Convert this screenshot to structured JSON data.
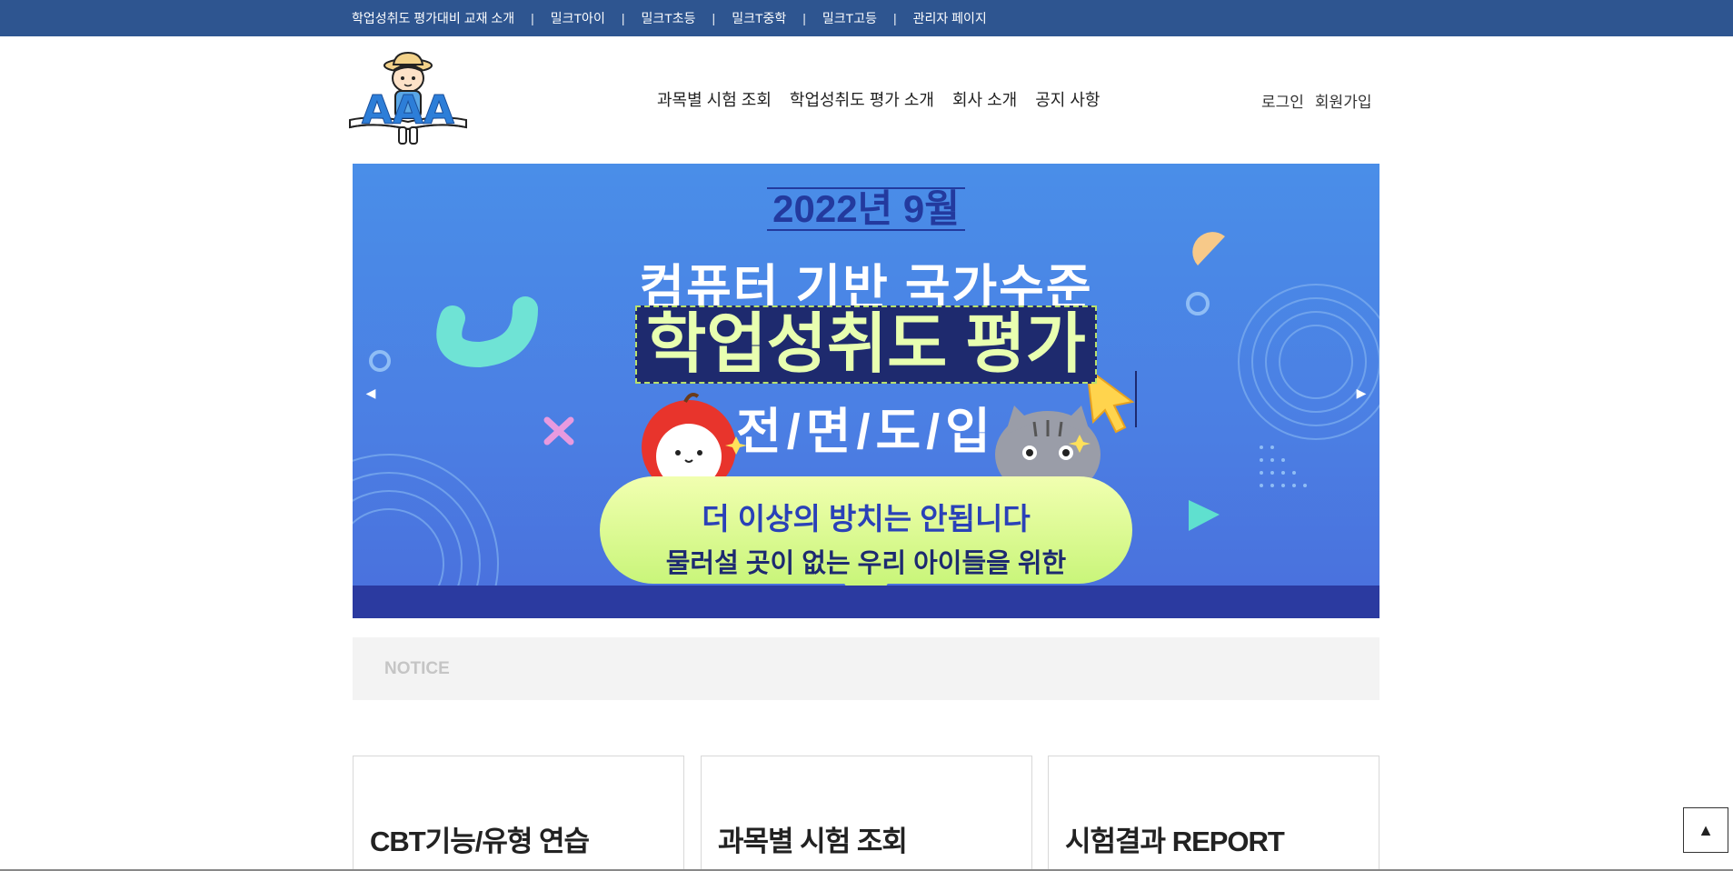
{
  "topbar": {
    "links": [
      {
        "label": "학업성취도 평가대비 교재 소개"
      },
      {
        "label": "밀크T아이"
      },
      {
        "label": "밀크T초등"
      },
      {
        "label": "밀크T중학"
      },
      {
        "label": "밀크T고등"
      },
      {
        "label": "관리자 페이지"
      }
    ],
    "separator": "|",
    "background": "#2e5590"
  },
  "header": {
    "logo_text": "AAA",
    "nav": [
      {
        "label": "과목별 시험 조회"
      },
      {
        "label": "학업성취도 평가 소개"
      },
      {
        "label": "회사 소개"
      },
      {
        "label": "공지 사항"
      }
    ],
    "auth": {
      "login": "로그인",
      "signup": "회원가입"
    }
  },
  "banner": {
    "date": "2022년 9월",
    "line1": "컴퓨터 기반 국가수준",
    "line2": "학업성취도 평가",
    "line3": "전/면/도/입",
    "bubble_line1": "더 이상의 방치는 안됩니다",
    "bubble_line2": "물러설 곳이 없는 우리 아이들을 위한",
    "prev_icon": "◀",
    "next_icon": "▶"
  },
  "notice": {
    "label": "NOTICE"
  },
  "cards": [
    {
      "title": "CBT기능/유형 연습"
    },
    {
      "title": "과목별 시험 조회"
    },
    {
      "title": "시험결과 REPORT"
    }
  ],
  "scroll_top": {
    "icon": "▲"
  }
}
